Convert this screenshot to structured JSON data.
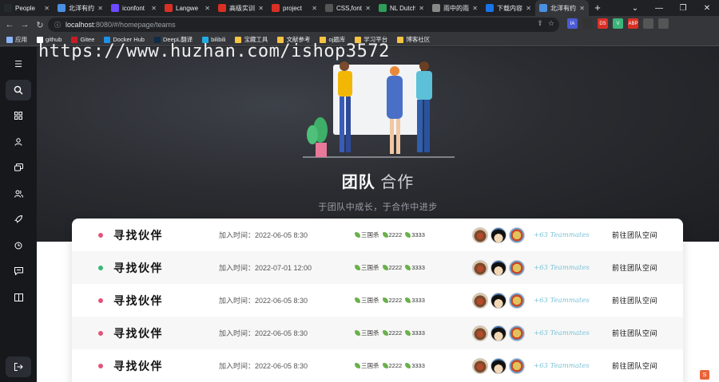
{
  "browser": {
    "tabs": [
      {
        "title": "People",
        "icon": "github-icon",
        "color": "#24292e",
        "active": false
      },
      {
        "title": "北洋有约",
        "icon": "page-icon",
        "color": "#4a90e2",
        "active": false
      },
      {
        "title": "iconfont",
        "icon": "iconfont-icon",
        "color": "#6d4aff",
        "active": false
      },
      {
        "title": "Langwe",
        "icon": "g-icon",
        "color": "#d93025",
        "active": false
      },
      {
        "title": "高级实训",
        "icon": "g-icon",
        "color": "#d93025",
        "active": false
      },
      {
        "title": "project",
        "icon": "g-icon",
        "color": "#d93025",
        "active": false
      },
      {
        "title": "CSS,font",
        "icon": "page-icon",
        "color": "#555555",
        "active": false
      },
      {
        "title": "NL Dutch",
        "icon": "grid-icon",
        "color": "#2e9e5b",
        "active": false
      },
      {
        "title": "雨中的雨",
        "icon": "page-icon",
        "color": "#888888",
        "active": false
      },
      {
        "title": "下载内容",
        "icon": "download-icon",
        "color": "#1a73e8",
        "active": false
      },
      {
        "title": "北洋有约",
        "icon": "page-icon",
        "color": "#4a90e2",
        "active": true
      }
    ],
    "url_host": "localhost",
    "url_rest": ":8080/#/homepage/teams",
    "bookmarks": [
      {
        "label": "应用",
        "type": "apps"
      },
      {
        "label": "github",
        "type": "github"
      },
      {
        "label": "Gitee",
        "type": "gitee"
      },
      {
        "label": "Docker Hub",
        "type": "docker"
      },
      {
        "label": "DeepL翻译",
        "type": "deepl"
      },
      {
        "label": "bilibili",
        "type": "bilibili"
      },
      {
        "label": "宝藏工具",
        "type": "folder"
      },
      {
        "label": "文献参考",
        "type": "folder"
      },
      {
        "label": "oj题库",
        "type": "folder"
      },
      {
        "label": "学习平台",
        "type": "folder"
      },
      {
        "label": "博客社区",
        "type": "folder"
      }
    ],
    "extensions": [
      "IA",
      "",
      "DS",
      "V",
      "ABP",
      "",
      ""
    ]
  },
  "watermark": "https://www.huzhan.com/ishop3572",
  "hero": {
    "title_strong": "团队",
    "title_light": "合作",
    "subtitle": "于团队中成长，于合作中进步"
  },
  "teams": [
    {
      "name": "寻找伙伴",
      "time": "加入时间：2022-06-05 8:30",
      "dot": "#e0557a",
      "tags": [
        "三国杀",
        "2222",
        "3333"
      ],
      "teammates": "+63 Teammates",
      "action": "前往团队空间"
    },
    {
      "name": "寻找伙伴",
      "time": "加入时间：2022-07-01 12:00",
      "dot": "#3bb57a",
      "tags": [
        "三国杀",
        "2222",
        "3333"
      ],
      "teammates": "+63 Teammates",
      "action": "前往团队空间"
    },
    {
      "name": "寻找伙伴",
      "time": "加入时间：2022-06-05 8:30",
      "dot": "#e0557a",
      "tags": [
        "三国杀",
        "2222",
        "3333"
      ],
      "teammates": "+63 Teammates",
      "action": "前往团队空间"
    },
    {
      "name": "寻找伙伴",
      "time": "加入时间：2022-06-05 8:30",
      "dot": "#e0557a",
      "tags": [
        "三国杀",
        "2222",
        "3333"
      ],
      "teammates": "+63 Teammates",
      "action": "前往团队空间"
    },
    {
      "name": "寻找伙伴",
      "time": "加入时间：2022-06-05 8:30",
      "dot": "#e0557a",
      "tags": [
        "三国杀",
        "2222",
        "3333"
      ],
      "teammates": "+63 Teammates",
      "action": "前往团队空间"
    }
  ]
}
